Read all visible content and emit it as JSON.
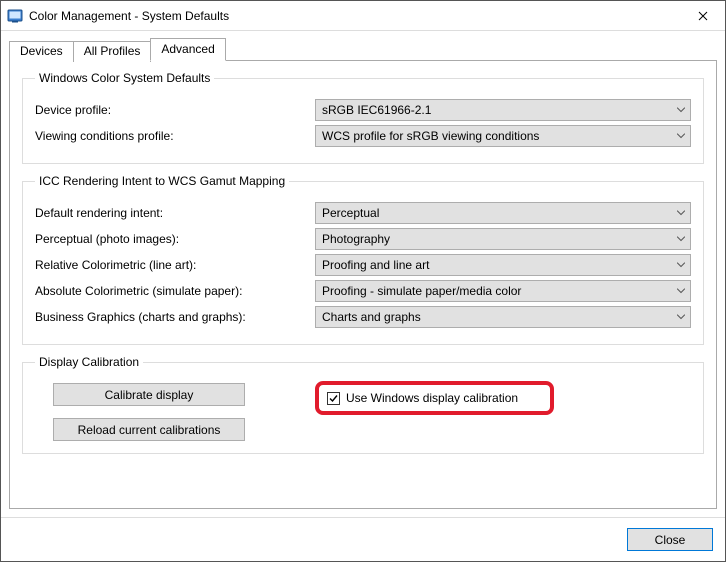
{
  "title": "Color Management - System Defaults",
  "tabs": {
    "devices": "Devices",
    "allProfiles": "All Profiles",
    "advanced": "Advanced"
  },
  "group1": {
    "legend": "Windows Color System Defaults",
    "deviceProfileLabel": "Device profile:",
    "deviceProfileValue": "sRGB IEC61966-2.1",
    "viewingLabel": "Viewing conditions profile:",
    "viewingValue": "WCS profile for sRGB viewing conditions"
  },
  "group2": {
    "legend": "ICC Rendering Intent to WCS Gamut Mapping",
    "rows": [
      {
        "label": "Default rendering intent:",
        "value": "Perceptual"
      },
      {
        "label": "Perceptual (photo images):",
        "value": "Photography"
      },
      {
        "label": "Relative Colorimetric (line art):",
        "value": "Proofing and line art"
      },
      {
        "label": "Absolute Colorimetric (simulate paper):",
        "value": "Proofing - simulate paper/media color"
      },
      {
        "label": "Business Graphics (charts and graphs):",
        "value": "Charts and graphs"
      }
    ]
  },
  "group3": {
    "legend": "Display Calibration",
    "calibrateBtn": "Calibrate display",
    "reloadBtn": "Reload current calibrations",
    "checkboxLabel": "Use Windows display calibration"
  },
  "footer": {
    "close": "Close"
  }
}
